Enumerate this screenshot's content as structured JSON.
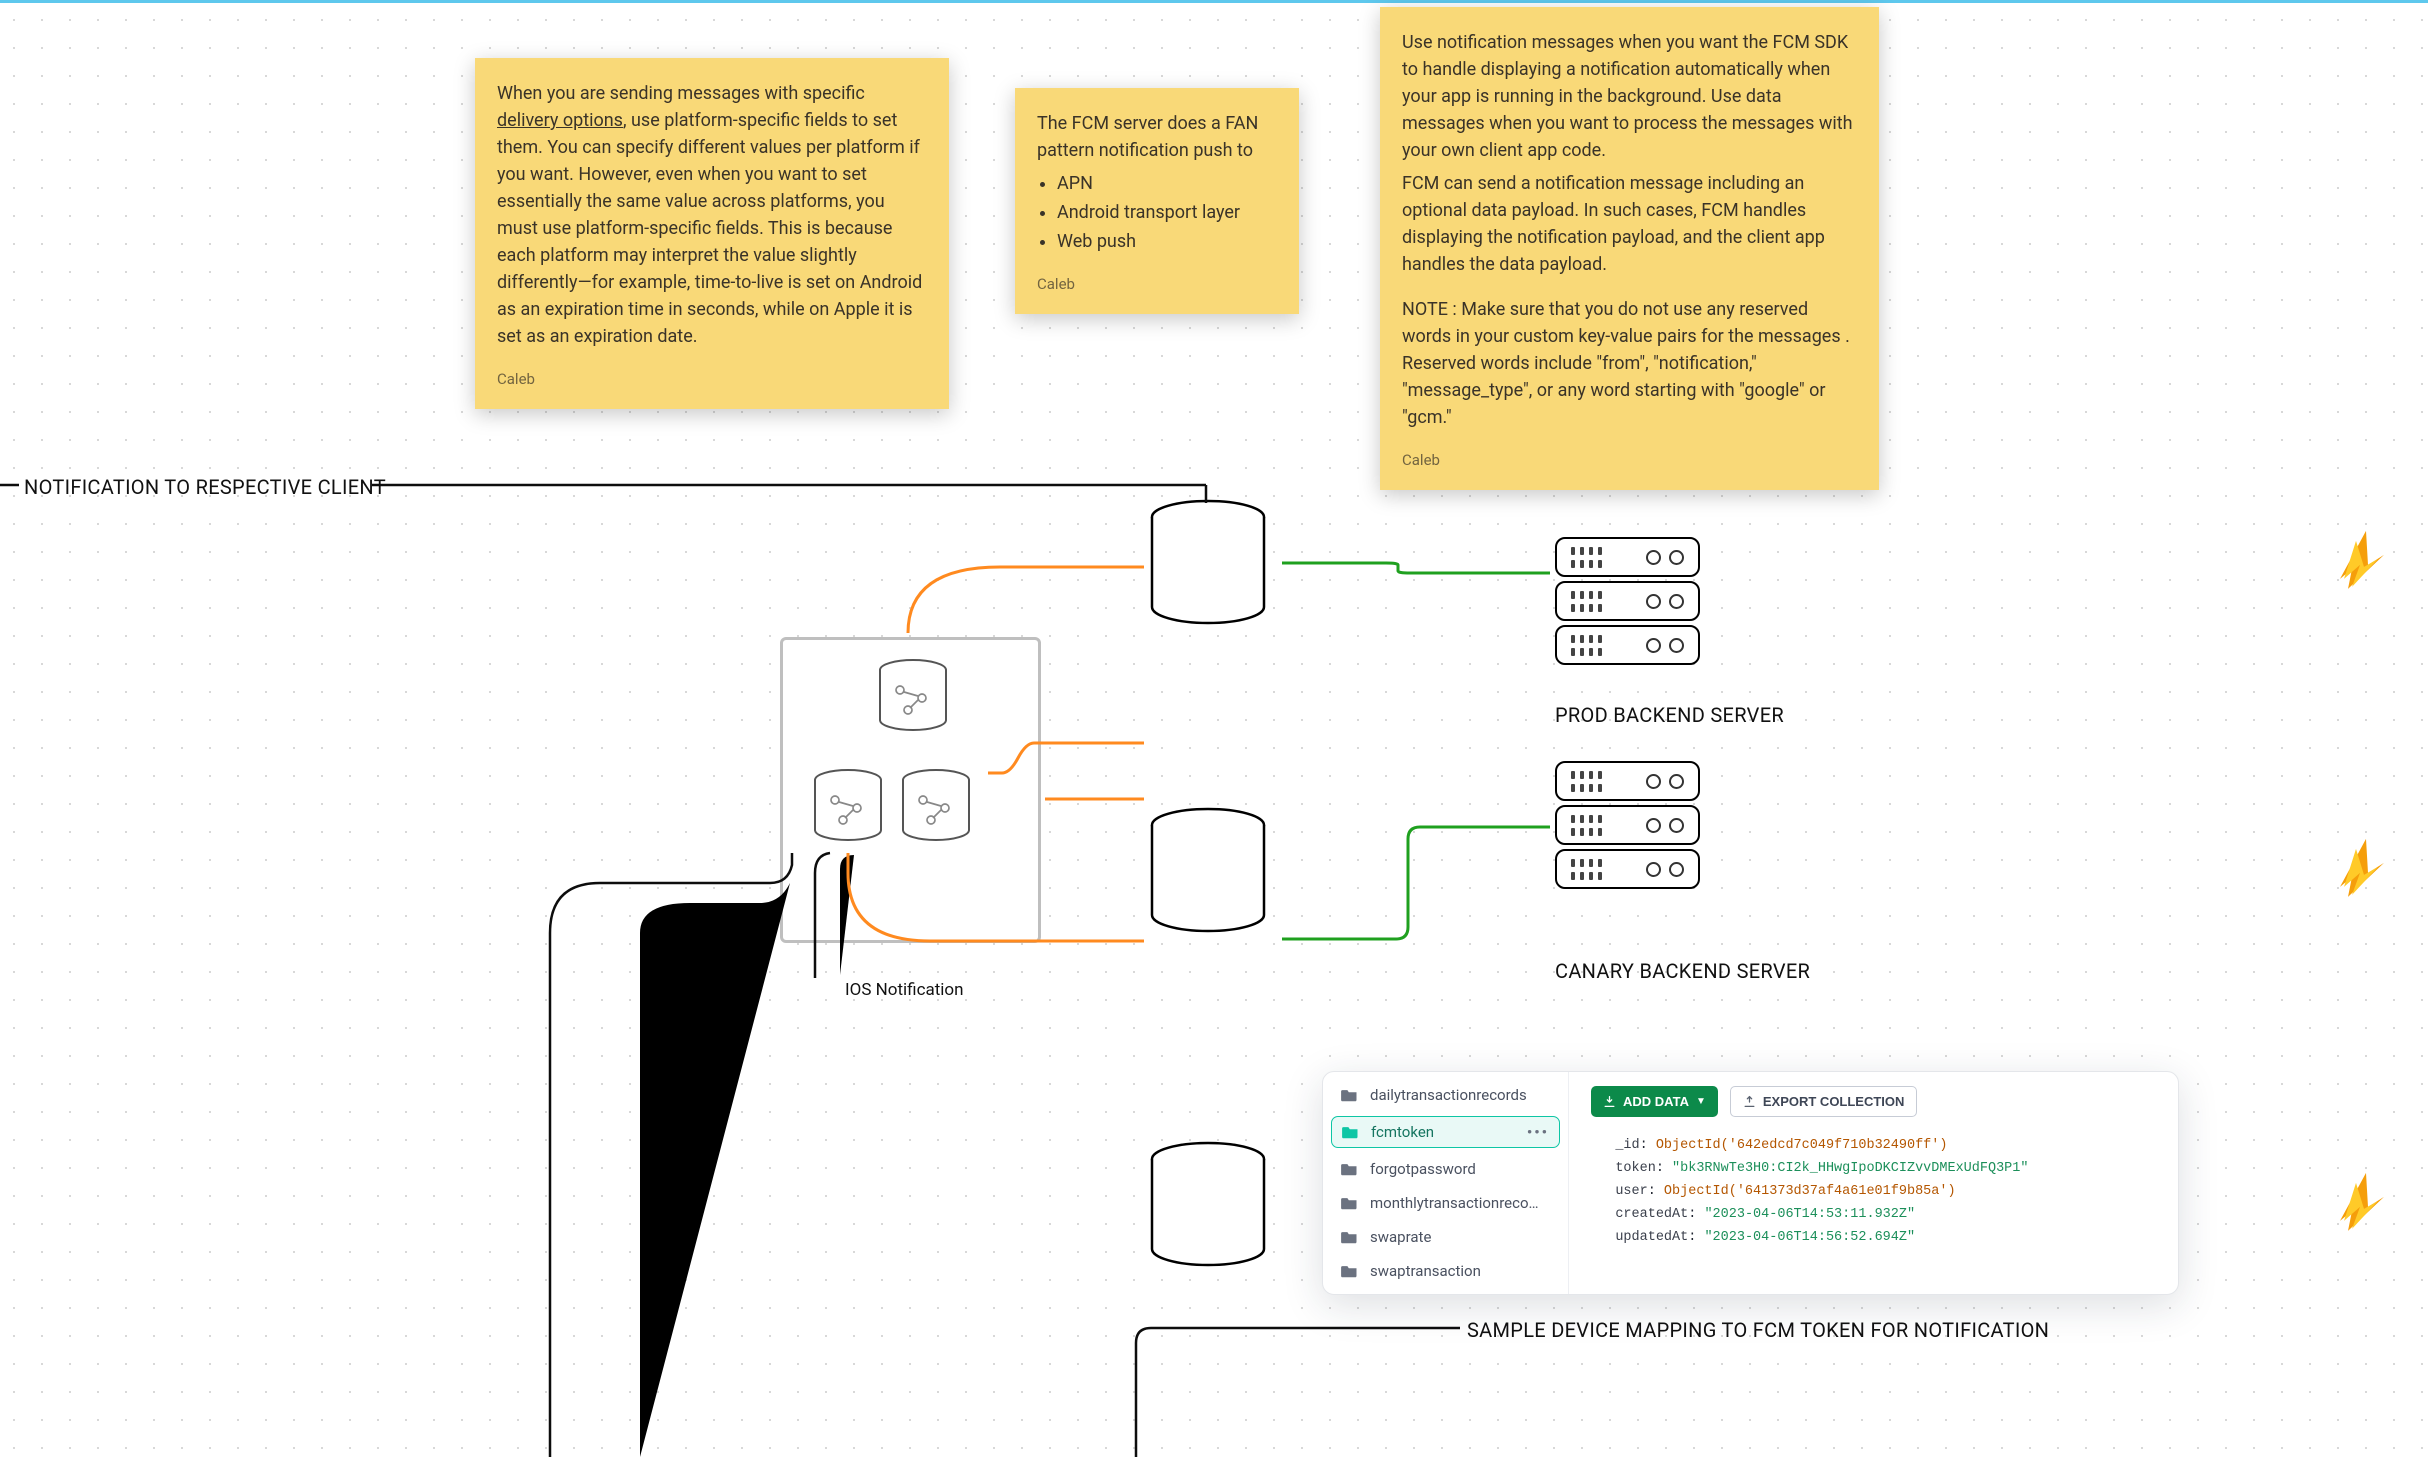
{
  "notes": {
    "n1": {
      "body1": "When you are sending messages with specific ",
      "link": "delivery options",
      "body2": ", use platform-specific fields to set them. You can specify different values per platform if you want. However, even when you want to set essentially the same value across platforms, you must use platform-specific fields. This is because each platform may interpret the value slightly differently—for example, time-to-live is set on Android as an expiration time in seconds, while on Apple it is set as an expiration date.",
      "author": "Caleb"
    },
    "n2": {
      "body": "The FCM server does a FAN pattern notification push to",
      "li1": "APN",
      "li2": "Android transport layer",
      "li3": "Web push",
      "author": "Caleb"
    },
    "n3": {
      "p1": "Use notification messages when you want the FCM SDK to handle displaying a notification automatically when your app is running in the background. Use data messages when you want to process the messages with your own client app code.",
      "p2": "FCM can send a notification message including an optional data payload. In such cases, FCM handles displaying the notification payload, and the client app handles the data payload.",
      "p3": "NOTE : Make sure that you do not use any reserved words in your custom key-value pairs for the messages . Reserved words include \"from\", \"notification,\" \"message_type\", or any word starting with \"google\" or \"gcm.\"",
      "author": "Caleb"
    }
  },
  "labels": {
    "notify": "NOTIFICATION TO RESPECTIVE CLIENT",
    "ios": "IOS Notification",
    "prod": "PROD BACKEND SERVER",
    "canary": "CANARY BACKEND SERVER",
    "sample": "SAMPLE DEVICE MAPPING TO FCM TOKEN FOR NOTIFICATION"
  },
  "mongo": {
    "collections": {
      "c1": "dailytransactionrecords",
      "c2": "fcmtoken",
      "c3": "forgotpassword",
      "c4": "monthlytransactionreco…",
      "c5": "swaprate",
      "c6": "swaptransaction"
    },
    "buttons": {
      "add": "ADD DATA",
      "export": "EXPORT COLLECTION"
    },
    "doc": {
      "id_k": "_id",
      "id_v": "ObjectId('642edcd7c049f710b32490ff')",
      "token_k": "token",
      "token_v": "\"bk3RNwTe3H0:CI2k_HHwgIpoDKCIZvvDMExUdFQ3P1\"",
      "user_k": "user",
      "user_v": "ObjectId('641373d37af4a61e01f9b85a')",
      "created_k": "createdAt",
      "created_v": "\"2023-04-06T14:53:11.932Z\"",
      "updated_k": "updatedAt",
      "updated_v": "\"2023-04-06T14:56:52.694Z\""
    }
  }
}
